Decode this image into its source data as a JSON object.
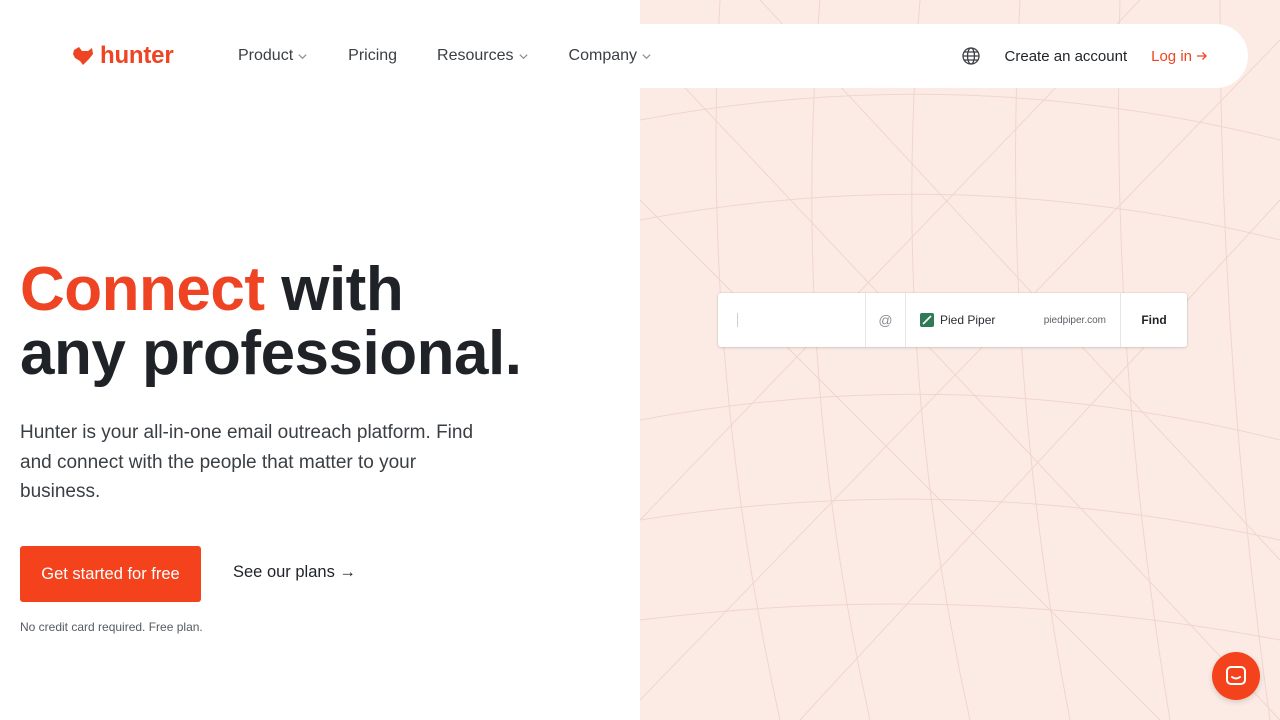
{
  "brand": {
    "name": "hunter",
    "accent_color": "#ef4423",
    "panel_color": "#fcebe5"
  },
  "nav": {
    "items": [
      {
        "label": "Product",
        "has_dropdown": true
      },
      {
        "label": "Pricing",
        "has_dropdown": false
      },
      {
        "label": "Resources",
        "has_dropdown": true
      },
      {
        "label": "Company",
        "has_dropdown": true
      }
    ],
    "globe_icon": "globe-icon",
    "create_account": "Create an account",
    "login": "Log in",
    "login_icon": "arrow-right-icon"
  },
  "hero": {
    "title_accent": "Connect",
    "title_rest_line1": " with",
    "title_line2": "any professional.",
    "description": "Hunter is your all-in-one email outreach platform. Find and connect with the people that matter to your business.",
    "cta_primary": "Get started for free",
    "cta_secondary": "See our plans →",
    "note": "No credit card required. Free plan."
  },
  "finder": {
    "name_value": "",
    "at_symbol": "@",
    "company_name": "Pied Piper",
    "company_domain": "piedpiper.com",
    "find_label": "Find"
  },
  "chat": {
    "icon": "chat-icon"
  }
}
